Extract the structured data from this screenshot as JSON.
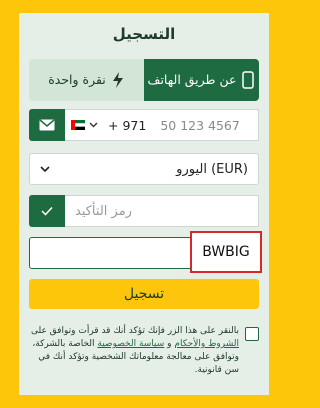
{
  "title": "التسجيل",
  "tabs": [
    {
      "label": "عن طريق الهاتف",
      "icon": "phone-icon",
      "active": true
    },
    {
      "label": "نقرة واحدة",
      "icon": "lightning-icon",
      "active": false
    }
  ],
  "phone": {
    "country_code": "+ 971",
    "placeholder": "50 123 4567",
    "country_icon": "uae-flag-icon"
  },
  "currency": {
    "value": "اليورو (EUR)"
  },
  "confirm_code": {
    "placeholder": "رمز التأكيد"
  },
  "captcha": {
    "text": "BWBIG"
  },
  "submit_label": "تسجيل",
  "agreement": {
    "part1": "بالنقر على هذا الزر فإنك تؤكد أنك قد قرأت وتوافق على ",
    "terms_link": "الشروط والأحكام",
    "part2": " و ",
    "privacy_link": "سياسة الخصوصية",
    "part3": " الخاصة بالشركة، وتوافق على معالجة معلوماتك الشخصية وتؤكد أنك في سن قانونية."
  },
  "colors": {
    "brand_green": "#1f6b41",
    "accent_yellow": "#fdc60a",
    "highlight_red": "#d42a2a"
  }
}
